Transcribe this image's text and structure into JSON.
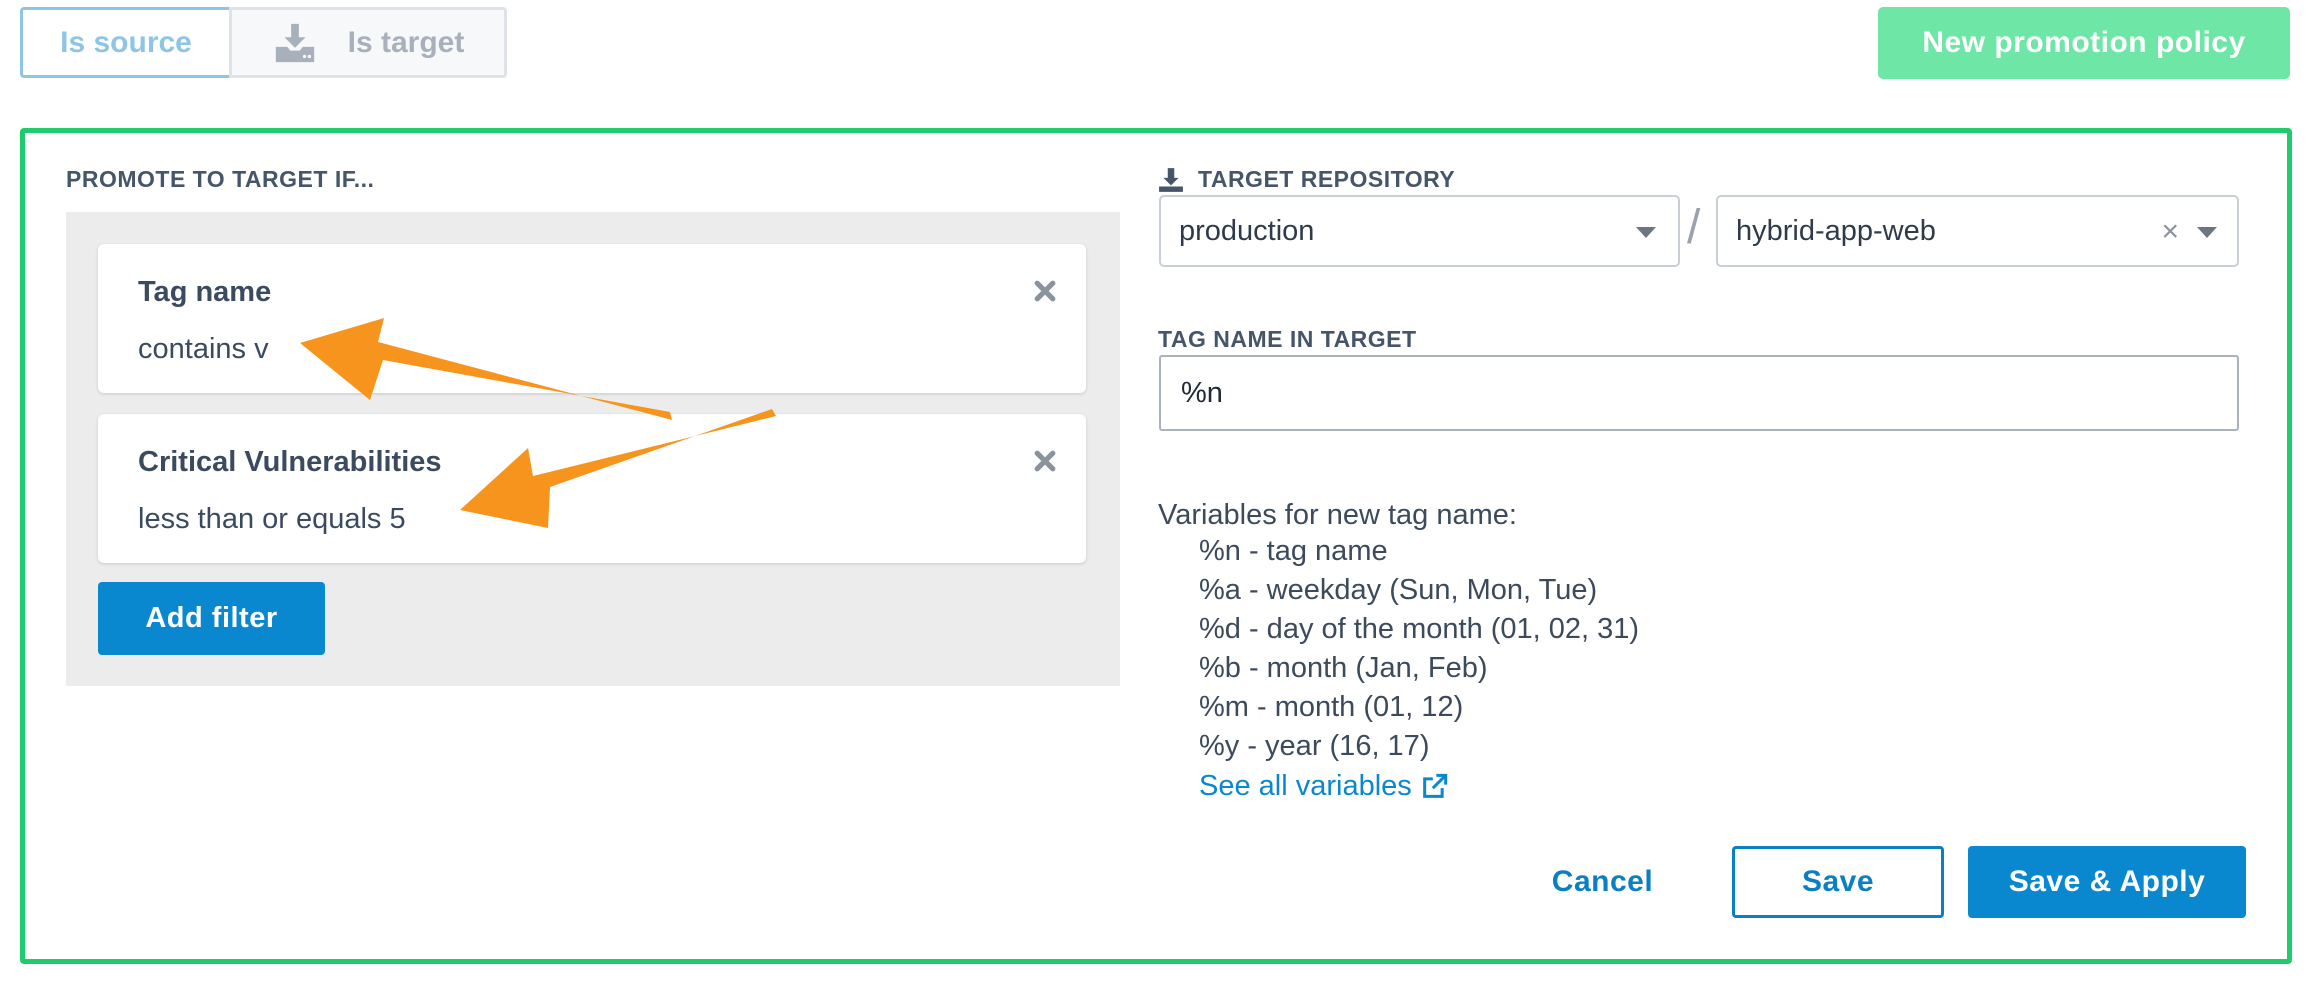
{
  "toggle": {
    "source_label": "Is source",
    "target_label": "Is target"
  },
  "new_policy_label": "New promotion policy",
  "filters": {
    "section_label": "PROMOTE TO TARGET IF...",
    "items": [
      {
        "title": "Tag name",
        "value": "contains v"
      },
      {
        "title": "Critical Vulnerabilities",
        "value": "less than or equals 5"
      }
    ],
    "add_label": "Add filter"
  },
  "target": {
    "section_label": "TARGET REPOSITORY",
    "registry": "production",
    "separator": "/",
    "repository": "hybrid-app-web",
    "clear_glyph": "×"
  },
  "tag_name": {
    "label": "TAG NAME IN TARGET",
    "value": "%n"
  },
  "variables": {
    "heading": "Variables for new tag name:",
    "items": [
      "%n - tag name",
      "%a - weekday (Sun, Mon, Tue)",
      "%d - day of the month (01, 02, 31)",
      "%b - month (Jan, Feb)",
      "%m - month (01, 12)",
      "%y - year (16, 17)"
    ],
    "link_label": "See all variables"
  },
  "actions": {
    "cancel": "Cancel",
    "save": "Save",
    "save_apply": "Save & Apply"
  },
  "colors": {
    "primary": "#0a88cf",
    "success_border": "#1fcc6b",
    "new_policy_bg": "#6ee6a6",
    "annotation_arrow": "#f7941d"
  },
  "icons": {
    "target_toggle": "download-tray-icon",
    "target_repo": "download-icon",
    "remove_filter": "close-icon",
    "external_link": "external-link-icon"
  }
}
